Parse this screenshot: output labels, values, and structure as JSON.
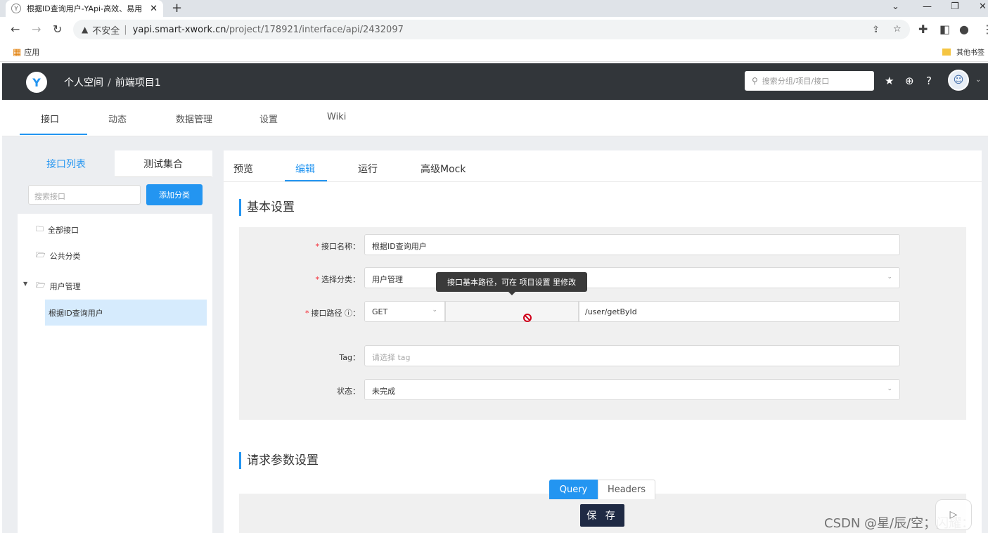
{
  "browser": {
    "tab_title": "根据ID查询用户-YApi-高效、易用",
    "tab_close": "✕",
    "new_tab": "+",
    "security_label": "不安全",
    "url_host": "yapi.smart-xwork.cn",
    "url_path": "/project/178921/interface/api/2432097",
    "bookmark_apps": "应用",
    "bookmark_other": "其他书签"
  },
  "header": {
    "space": "个人空间",
    "project": "前端项目1",
    "search_placeholder": "搜索分组/项目/接口"
  },
  "subnav": {
    "items": [
      "接口",
      "动态",
      "数据管理",
      "设置",
      "Wiki"
    ]
  },
  "left_panel": {
    "tabs": [
      "接口列表",
      "测试集合"
    ],
    "search_placeholder": "搜索接口",
    "add_button": "添加分类",
    "tree": [
      "全部接口",
      "公共分类",
      "用户管理"
    ],
    "selected_item": "根据ID查询用户"
  },
  "right_panel": {
    "tabs": [
      "预览",
      "编辑",
      "运行",
      "高级Mock"
    ],
    "basic_title": "基本设置",
    "form": {
      "name_label": "接口名称：",
      "name_value": "根据ID查询用户",
      "category_label": "选择分类：",
      "category_value": "用户管理",
      "path_label": "接口路径",
      "path_label_suffix": "：",
      "method": "GET",
      "path_value": "/user/getById",
      "tooltip": "接口基本路径，可在 项目设置 里修改",
      "tag_label": "Tag：",
      "tag_placeholder": "请选择 tag",
      "status_label": "状态：",
      "status_value": "未完成"
    },
    "request_title": "请求参数设置",
    "param_tabs": [
      "Query",
      "Headers"
    ],
    "save_button": "保 存"
  },
  "watermark": "CSDN @星/辰/空；闪耀：",
  "colors": {
    "accent": "#2395f1",
    "header_bg": "#32363a",
    "required": "#f5222d",
    "save_bg": "#1f2a44"
  },
  "icons": [
    "favicon-icon",
    "back-icon",
    "forward-icon",
    "reload-icon",
    "warning-icon",
    "share-icon",
    "star-icon",
    "puzzle-icon",
    "sidepanel-icon",
    "profile-icon",
    "more-icon",
    "apps-grid-icon",
    "folder-icon",
    "yapi-logo",
    "search-icon",
    "star-icon",
    "add-icon",
    "help-icon",
    "avatar",
    "chevron-down-icon",
    "question-circle-icon",
    "no-entry-icon"
  ]
}
